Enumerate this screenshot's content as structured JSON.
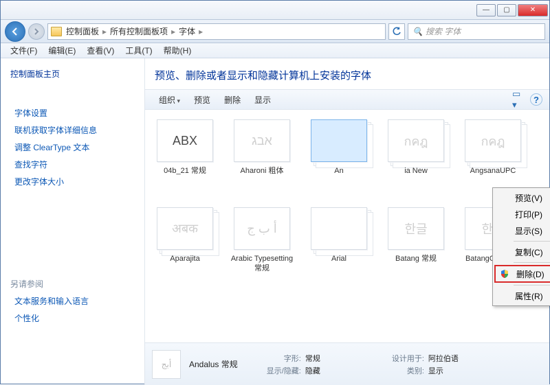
{
  "titlebar": {
    "min": "—",
    "max": "▢",
    "close": "✕"
  },
  "breadcrumb": {
    "root": "控制面板",
    "level2": "所有控制面板项",
    "leaf": "字体",
    "sep": "▸"
  },
  "search": {
    "placeholder": "搜索 字体"
  },
  "menu": {
    "file": "文件(F)",
    "edit": "编辑(E)",
    "view": "查看(V)",
    "tools": "工具(T)",
    "help": "帮助(H)"
  },
  "sidebar": {
    "home": "控制面板主页",
    "links": [
      "字体设置",
      "联机获取字体详细信息",
      "调整 ClearType 文本",
      "查找字符",
      "更改字体大小"
    ],
    "also_head": "另请参阅",
    "also": [
      "文本服务和输入语言",
      "个性化"
    ]
  },
  "main_title": "预览、删除或者显示和隐藏计算机上安装的字体",
  "toolbar": {
    "org": "组织",
    "preview": "预览",
    "delete": "删除",
    "show": "显示"
  },
  "fonts": [
    {
      "name": "04b_21 常规",
      "sample": "ABX",
      "dim": false,
      "stack": false
    },
    {
      "name": "Aharoni 粗体",
      "sample": "אבג",
      "dim": true,
      "stack": false
    },
    {
      "name": "An",
      "sample": "",
      "dim": false,
      "stack": true,
      "selected": true
    },
    {
      "name": "ia New",
      "sample": "กคฎ",
      "dim": true,
      "stack": true
    },
    {
      "name": "AngsanaUPC",
      "sample": "กคฎ",
      "dim": true,
      "stack": true
    },
    {
      "name": "Aparajita",
      "sample": "अबक",
      "dim": true,
      "stack": true
    },
    {
      "name": "Arabic Typesetting 常规",
      "sample": "أ ب ج",
      "dim": true,
      "stack": false
    },
    {
      "name": "Arial",
      "sample": "",
      "dim": false,
      "stack": true
    },
    {
      "name": "Batang 常规",
      "sample": "한글",
      "dim": true,
      "stack": false
    },
    {
      "name": "BatangChe 常规",
      "sample": "한글",
      "dim": true,
      "stack": false
    }
  ],
  "context": {
    "preview": "预览(V)",
    "print": "打印(P)",
    "show": "显示(S)",
    "copy": "复制(C)",
    "delete": "删除(D)",
    "props": "属性(R)"
  },
  "details": {
    "name": "Andalus 常规",
    "k_style": "字形:",
    "v_style": "常规",
    "k_hide": "显示/隐藏:",
    "v_hide": "隐藏",
    "k_design": "设计用于:",
    "v_design": "阿拉伯语",
    "k_cat": "类别:",
    "v_cat": "显示"
  }
}
